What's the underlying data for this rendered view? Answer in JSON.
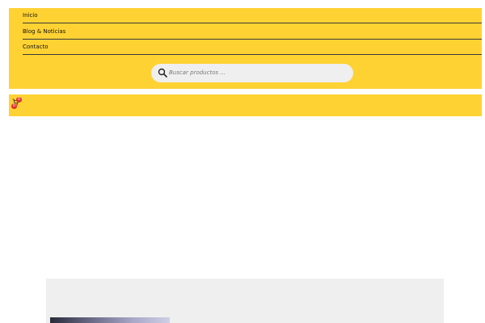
{
  "nav": {
    "items": [
      {
        "label": "Inicio"
      },
      {
        "label": "Blog & Noticias"
      },
      {
        "label": "Contacto"
      }
    ]
  },
  "search": {
    "placeholder": "Buscar productos ..."
  },
  "cart": {
    "badge_top": "0",
    "badge_left": "0"
  },
  "colors": {
    "accent": "#ffd233",
    "badge": "#e0302f",
    "panel": "#efefef"
  },
  "icons": {
    "search": "search-icon",
    "cart": "cart-icon"
  }
}
